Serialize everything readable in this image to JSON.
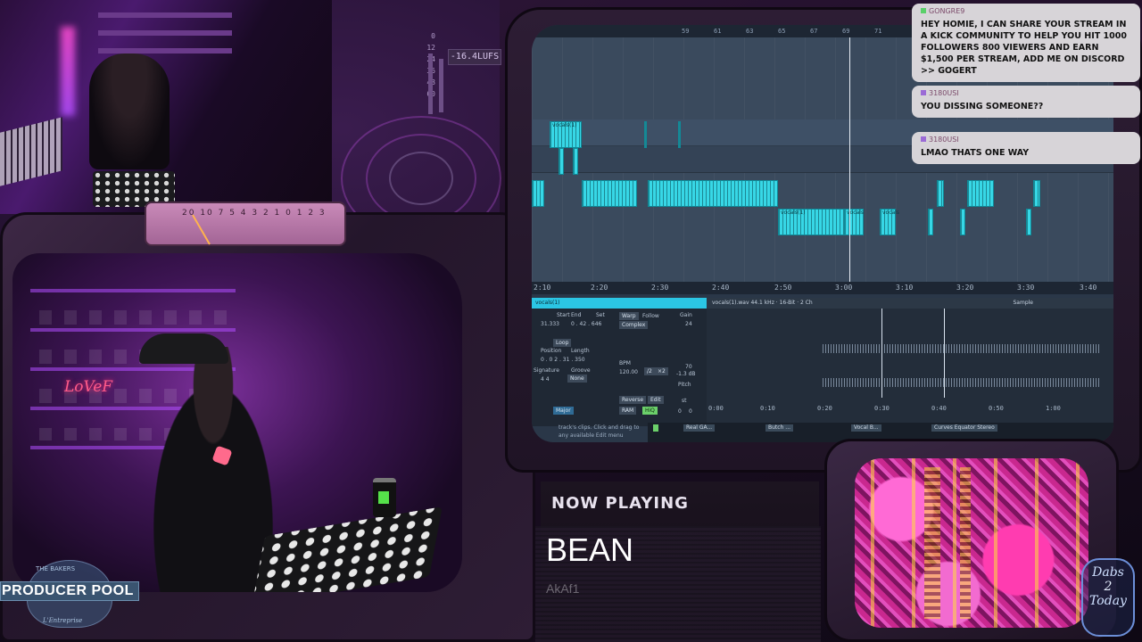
{
  "overlay": {
    "loudness_readout": "-16.4LUFS",
    "meter_scale": [
      "0",
      "12",
      "24",
      "36",
      "48",
      "60"
    ],
    "vu_scale": "20 10 7 5 4 3 2 1 0 1 2 3"
  },
  "daw": {
    "ruler_ticks": [
      "59",
      "61",
      "63",
      "65",
      "67",
      "69",
      "71"
    ],
    "time_ticks": [
      "2:10",
      "2:20",
      "2:30",
      "2:40",
      "2:50",
      "3:00",
      "3:10",
      "3:20",
      "3:30",
      "3:40"
    ],
    "clip_names": [
      "vocals(1)",
      "vocals(1)",
      "vocals",
      "vocals"
    ],
    "clip_view": {
      "header": "vocals(1)",
      "start_label": "Start",
      "end_label": "End",
      "set_label": "Set",
      "start_value": "31.333",
      "end_value": "0 . 42 . 646",
      "warp_label": "Warp",
      "follow_label": "Follow",
      "warp_mode": "Complex",
      "loop_label": "Loop",
      "position_label": "Position",
      "length_label": "Length",
      "loop_values": "0 . 0   2 . 31 . 350",
      "signature_label": "Signature",
      "groove_label": "Groove",
      "sig_values": "4   4",
      "groove_value": "None",
      "bpm_label": "BPM",
      "bpm_value": "120.00",
      "halve": "/2",
      "double": "×2",
      "reverse_label": "Reverse",
      "edit_label": "Edit",
      "ram_label": "RAM",
      "hiq_label": "HiQ",
      "scale_value": "Major",
      "gain_label": "Gain",
      "gain_top": "24",
      "gain_mid": "70",
      "gain_db": "-1.3 dB",
      "pitch_label": "Pitch",
      "pitch_st": "st",
      "pitch_value": "0",
      "pitch_cents": "0"
    },
    "waveform": {
      "header": "vocals(1).wav  44.1 kHz · 16-Bit · 2 Ch",
      "sample_label": "Sample",
      "ticks": [
        "0:00",
        "0:10",
        "0:20",
        "0:30",
        "0:40",
        "0:50",
        "1:00"
      ]
    },
    "devices": [
      "Real GA...",
      "Butch ...",
      "Vocal B...",
      "Curves Equator Stereo"
    ],
    "device_hint_1": "track's clips. Click and drag to",
    "device_hint_2": "any available Edit menu"
  },
  "chat": [
    {
      "user": "GONGRE9",
      "text": "HEY HOMIE, I CAN SHARE YOUR STREAM IN A KICK COMMUNITY TO HELP YOU HIT 1000 FOLLOWERS 800 VIEWERS AND EARN $1,500 PER STREAM, ADD ME ON DISCORD >> GOGERT"
    },
    {
      "user": "3180USI",
      "text": "YOU DISSING SOMEONE??"
    },
    {
      "user": "3180USI",
      "text": "LMAO THATS ONE WAY"
    }
  ],
  "now_playing": {
    "label": "NOW PLAYING",
    "title": "BEAN",
    "artist": "AkAf1"
  },
  "branding": {
    "pool_crest_top": "THE BAKERS",
    "pool_label": "PRODUCER POOL",
    "pool_crest_bottom": "L'Entreprise",
    "dabs_line1": "Dabs",
    "dabs_line2": "2",
    "dabs_line3": "Today",
    "neon_sign": "LoVeF"
  },
  "colors": {
    "clip_cyan": "#37d7e6",
    "chat_bg": "#d7d4d8",
    "accent_purple": "#b04dff"
  }
}
